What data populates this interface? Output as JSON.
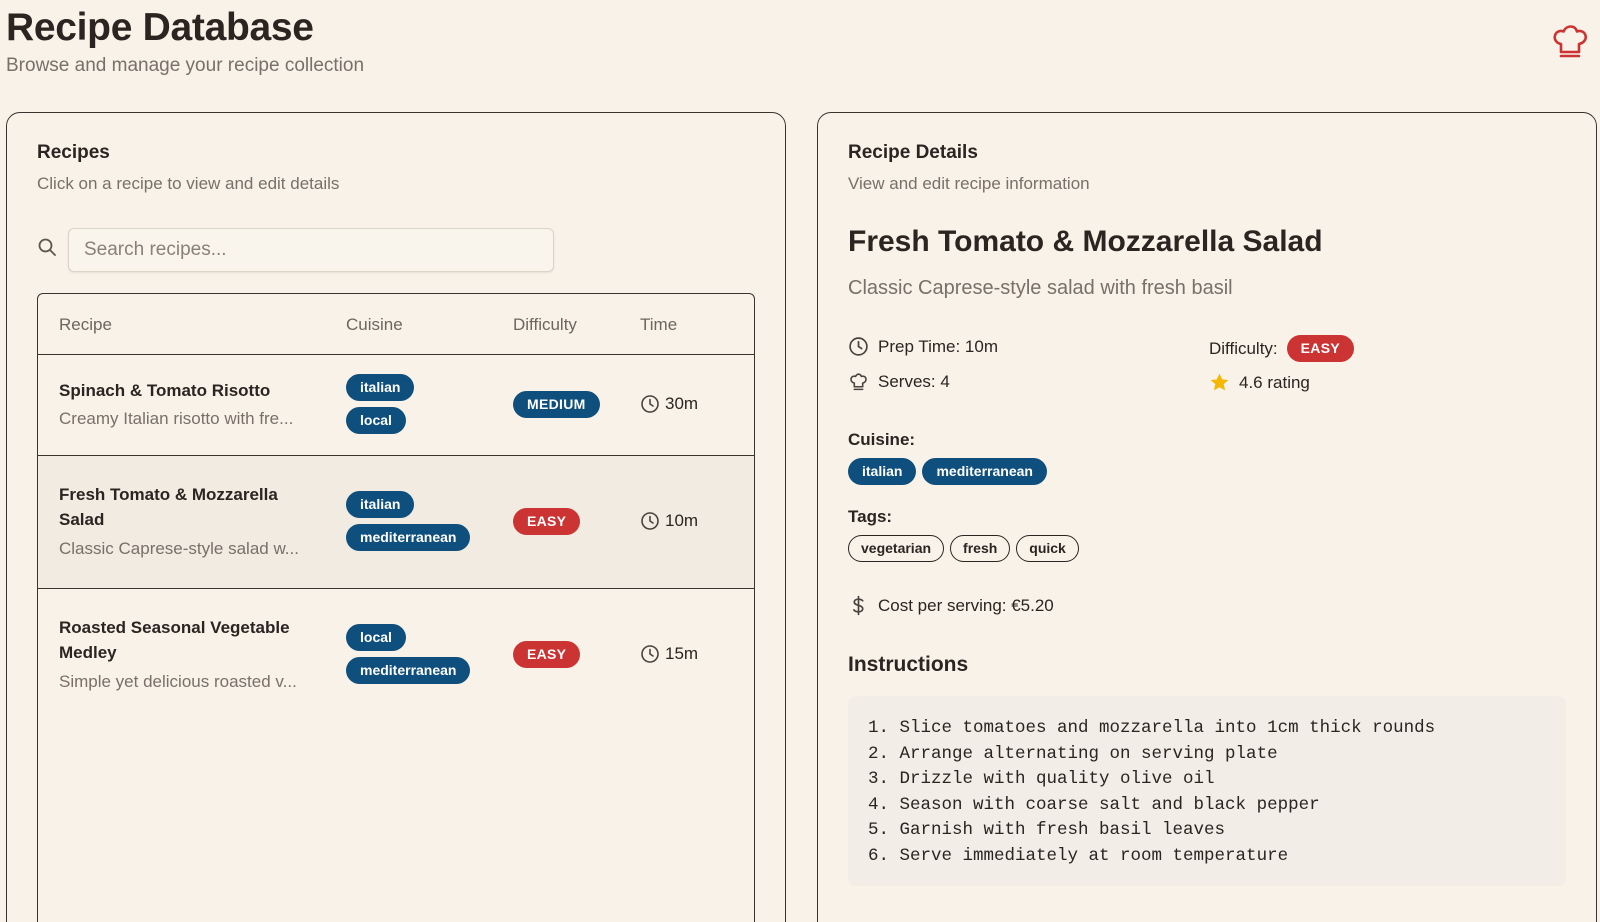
{
  "app": {
    "title": "Recipe Database",
    "subtitle": "Browse and manage your recipe collection",
    "logo_icon": "chef-hat-icon",
    "accent_color": "#cc3333",
    "primary_color": "#0e4f7d"
  },
  "recipes_panel": {
    "title": "Recipes",
    "subtitle": "Click on a recipe to view and edit details",
    "search": {
      "placeholder": "Search recipes...",
      "value": ""
    },
    "columns": [
      "Recipe",
      "Cuisine",
      "Difficulty",
      "Time"
    ],
    "rows": [
      {
        "name": "Spinach & Tomato Risotto",
        "desc": "Creamy Italian risotto with fre...",
        "cuisines": [
          "italian",
          "local"
        ],
        "difficulty": "MEDIUM",
        "time": "30m",
        "selected": false
      },
      {
        "name": "Fresh Tomato & Mozzarella Salad",
        "desc": "Classic Caprese-style salad w...",
        "cuisines": [
          "italian",
          "mediterranean"
        ],
        "difficulty": "EASY",
        "time": "10m",
        "selected": true
      },
      {
        "name": "Roasted Seasonal Vegetable Medley",
        "desc": "Simple yet delicious roasted v...",
        "cuisines": [
          "local",
          "mediterranean"
        ],
        "difficulty": "EASY",
        "time": "15m",
        "selected": false
      }
    ]
  },
  "details_panel": {
    "title": "Recipe Details",
    "subtitle": "View and edit recipe information",
    "recipe": {
      "name": "Fresh Tomato & Mozzarella Salad",
      "description": "Classic Caprese-style salad with fresh basil",
      "prep_time": "Prep Time: 10m",
      "serves": "Serves: 4",
      "difficulty_label": "Difficulty:",
      "difficulty": "EASY",
      "rating": "4.6 rating",
      "cuisine_label": "Cuisine:",
      "cuisines": [
        "italian",
        "mediterranean"
      ],
      "tags_label": "Tags:",
      "tags": [
        "vegetarian",
        "fresh",
        "quick"
      ],
      "cost": "Cost per serving: €5.20",
      "instructions_title": "Instructions",
      "instructions": [
        "1. Slice tomatoes and mozzarella into 1cm thick rounds",
        "2. Arrange alternating on serving plate",
        "3. Drizzle with quality olive oil",
        "4. Season with coarse salt and black pepper",
        "5. Garnish with fresh basil leaves",
        "6. Serve immediately at room temperature"
      ]
    }
  }
}
